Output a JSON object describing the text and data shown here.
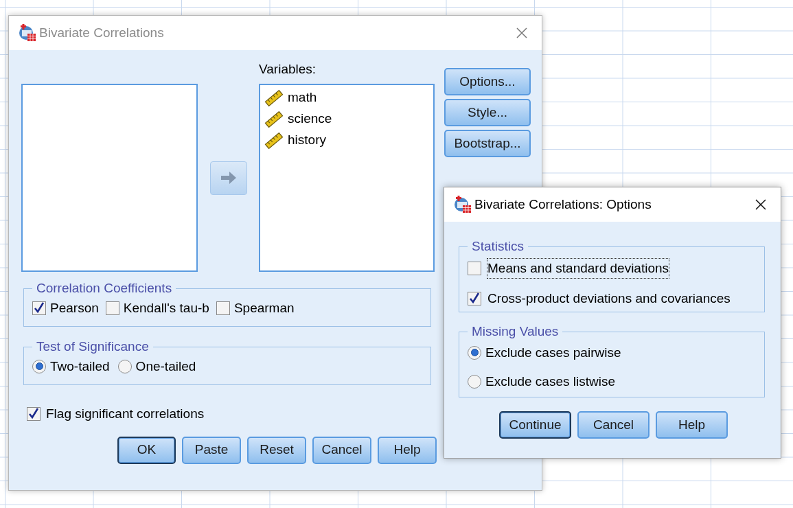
{
  "main_dialog": {
    "title": "Bivariate Correlations",
    "active": false,
    "variables": {
      "label": "Variables:",
      "items": [
        {
          "name": "math"
        },
        {
          "name": "science"
        },
        {
          "name": "history"
        }
      ]
    },
    "side_buttons": [
      "Options...",
      "Style...",
      "Bootstrap..."
    ],
    "correlation_coefficients": {
      "title": "Correlation Coefficients",
      "options": [
        {
          "label": "Pearson",
          "checked": true
        },
        {
          "label": "Kendall's tau-b",
          "checked": false
        },
        {
          "label": "Spearman",
          "checked": false
        }
      ]
    },
    "test_of_significance": {
      "title": "Test of Significance",
      "options": [
        {
          "label": "Two-tailed",
          "selected": true
        },
        {
          "label": "One-tailed",
          "selected": false
        }
      ]
    },
    "flag": {
      "label": "Flag significant correlations",
      "checked": true
    },
    "buttons": [
      {
        "label": "OK",
        "default": true
      },
      {
        "label": "Paste",
        "default": false
      },
      {
        "label": "Reset",
        "default": false
      },
      {
        "label": "Cancel",
        "default": false
      },
      {
        "label": "Help",
        "default": false
      }
    ]
  },
  "options_dialog": {
    "title": "Bivariate Correlations: Options",
    "active": true,
    "statistics": {
      "title": "Statistics",
      "options": [
        {
          "label": "Means and standard deviations",
          "checked": false,
          "focused": true
        },
        {
          "label": "Cross-product deviations and covariances",
          "checked": true,
          "focused": false
        }
      ]
    },
    "missing_values": {
      "title": "Missing Values",
      "options": [
        {
          "label": "Exclude cases pairwise",
          "selected": true
        },
        {
          "label": "Exclude cases listwise",
          "selected": false
        }
      ]
    },
    "buttons": [
      {
        "label": "Continue",
        "default": true
      },
      {
        "label": "Cancel",
        "default": false
      },
      {
        "label": "Help",
        "default": false
      }
    ]
  }
}
